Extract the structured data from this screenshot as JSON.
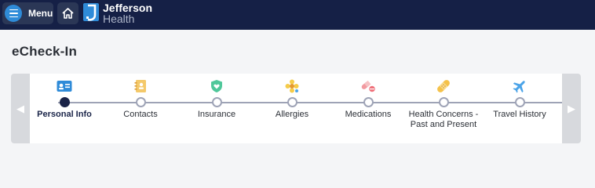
{
  "header": {
    "menu_label": "Menu",
    "logo_line1": "Jefferson",
    "logo_line2": "Health",
    "colors": {
      "bar": "#152046",
      "accent": "#2f8bd8"
    }
  },
  "page": {
    "title": "eCheck-In"
  },
  "stepper": {
    "active_index": 0,
    "steps": [
      {
        "label": "Personal Info",
        "icon": "id-card-icon"
      },
      {
        "label": "Contacts",
        "icon": "address-book-icon"
      },
      {
        "label": "Insurance",
        "icon": "shield-heart-icon"
      },
      {
        "label": "Allergies",
        "icon": "pollen-flower-icon"
      },
      {
        "label": "Medications",
        "icon": "pills-icon"
      },
      {
        "label": "Health Concerns - Past and Present",
        "icon": "bandage-icon"
      },
      {
        "label": "Travel History",
        "icon": "airplane-icon"
      }
    ]
  }
}
